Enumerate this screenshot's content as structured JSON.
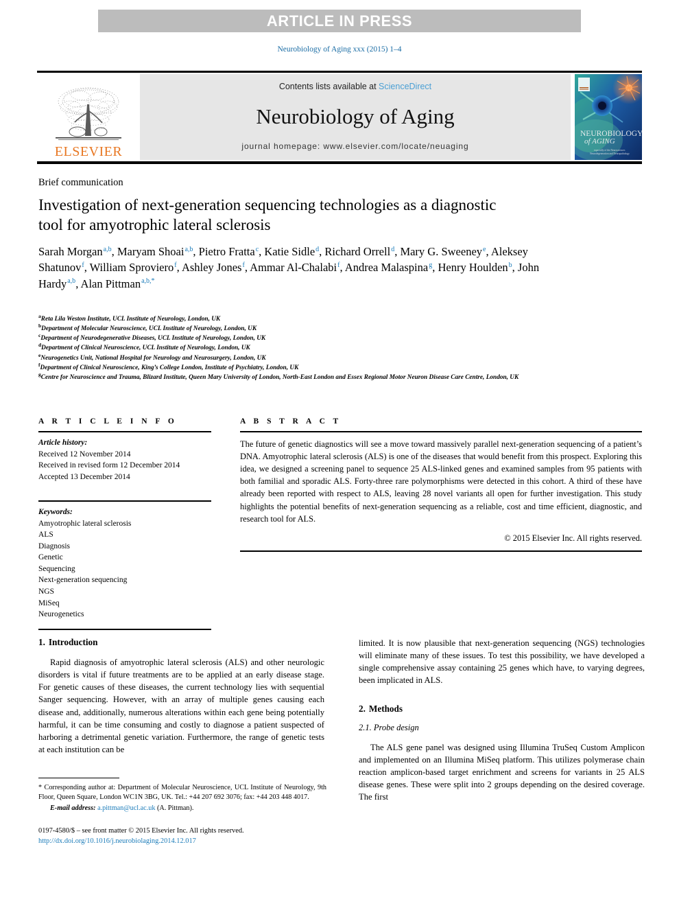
{
  "banner": {
    "label": "ARTICLE IN PRESS"
  },
  "running_head": "Neurobiology of Aging xxx (2015) 1–4",
  "masthead": {
    "contents_prefix": "Contents lists available at ",
    "sciencedirect": "ScienceDirect",
    "journal_title": "Neurobiology of Aging",
    "homepage": "journal homepage: www.elsevier.com/locate/neuaging",
    "publisher_wordmark": "ELSEVIER",
    "cover_title_line1": "NEUROBIOLOGY",
    "cover_title_line2": "of AGING",
    "cover_subtitle_line1": "especially of the Neurosciences",
    "cover_subtitle_line2": "Neurodegeneration and Neuropathology"
  },
  "colors": {
    "link_blue": "#1a7bb9",
    "sciencedirect_blue": "#4a9fd4",
    "elsevier_orange": "#e87722",
    "banner_grey": "#bcbcbc",
    "masthead_grey": "#e6e6e6"
  },
  "article_type": "Brief communication",
  "title": "Investigation of next-generation sequencing technologies as a diagnostic tool for amyotrophic lateral sclerosis",
  "authors": [
    {
      "name": "Sarah Morgan",
      "sup": "a,b",
      "sep": ", "
    },
    {
      "name": "Maryam Shoai",
      "sup": "a,b",
      "sep": ", "
    },
    {
      "name": "Pietro Fratta",
      "sup": "c",
      "sep": ", "
    },
    {
      "name": "Katie Sidle",
      "sup": "d",
      "sep": ", "
    },
    {
      "name": "Richard Orrell",
      "sup": "d",
      "sep": ", "
    },
    {
      "name": "Mary G. Sweeney",
      "sup": "e",
      "sep": ", "
    },
    {
      "name": "Aleksey Shatunov",
      "sup": "f",
      "sep": ", "
    },
    {
      "name": "William Sproviero",
      "sup": "f",
      "sep": ", "
    },
    {
      "name": "Ashley Jones",
      "sup": "f",
      "sep": ", "
    },
    {
      "name": "Ammar Al-Chalabi",
      "sup": "f",
      "sep": ", "
    },
    {
      "name": "Andrea Malaspina",
      "sup": "g",
      "sep": ", "
    },
    {
      "name": "Henry Houlden",
      "sup": "b",
      "sep": ", "
    },
    {
      "name": "John Hardy",
      "sup": "a,b",
      "sep": ", "
    },
    {
      "name": "Alan Pittman",
      "sup": "a,b,*",
      "sep": ""
    }
  ],
  "affiliations": [
    {
      "mark": "a",
      "text": "Reta Lila Weston Institute, UCL Institute of Neurology, London, UK"
    },
    {
      "mark": "b",
      "text": "Department of Molecular Neuroscience, UCL Institute of Neurology, London, UK"
    },
    {
      "mark": "c",
      "text": "Department of Neurodegenerative Diseases, UCL Institute of Neurology, London, UK"
    },
    {
      "mark": "d",
      "text": "Department of Clinical Neuroscience, UCL Institute of Neurology, London, UK"
    },
    {
      "mark": "e",
      "text": "Neurogenetics Unit, National Hospital for Neurology and Neurosurgery, London, UK"
    },
    {
      "mark": "f",
      "text": "Department of Clinical Neuroscience, King’s College London, Institute of Psychiatry, London, UK"
    },
    {
      "mark": "g",
      "text": "Centre for Neuroscience and Trauma, Blizard Institute, Queen Mary University of London, North-East London and Essex Regional Motor Neuron Disease Care Centre, London, UK"
    }
  ],
  "article_info": {
    "heading": "A R T I C L E  I N F O",
    "history_label": "Article history:",
    "history": [
      "Received 12 November 2014",
      "Received in revised form 12 December 2014",
      "Accepted 13 December 2014"
    ],
    "keywords_label": "Keywords:",
    "keywords": [
      "Amyotrophic lateral sclerosis",
      "ALS",
      "Diagnosis",
      "Genetic",
      "Sequencing",
      "Next-generation sequencing",
      "NGS",
      "MiSeq",
      "Neurogenetics"
    ]
  },
  "abstract": {
    "heading": "A B S T R A C T",
    "text": "The future of genetic diagnostics will see a move toward massively parallel next-generation sequencing of a patient’s DNA. Amyotrophic lateral sclerosis (ALS) is one of the diseases that would benefit from this prospect. Exploring this idea, we designed a screening panel to sequence 25 ALS-linked genes and examined samples from 95 patients with both familial and sporadic ALS. Forty-three rare polymorphisms were detected in this cohort. A third of these have already been reported with respect to ALS, leaving 28 novel variants all open for further investigation. This study highlights the potential benefits of next-generation sequencing as a reliable, cost and time efficient, diagnostic, and research tool for ALS.",
    "copyright": "© 2015 Elsevier Inc. All rights reserved."
  },
  "body": {
    "left_column": {
      "section_number": "1.",
      "section_title": "Introduction",
      "paragraph": "Rapid diagnosis of amyotrophic lateral sclerosis (ALS) and other neurologic disorders is vital if future treatments are to be applied at an early disease stage. For genetic causes of these diseases, the current technology lies with sequential Sanger sequencing. However, with an array of multiple genes causing each disease and, additionally, numerous alterations within each gene being potentially harmful, it can be time consuming and costly to diagnose a patient suspected of harboring a detrimental genetic variation. Furthermore, the range of genetic tests at each institution can be"
    },
    "right_column": {
      "paragraph_continued": "limited. It is now plausible that next-generation sequencing (NGS) technologies will eliminate many of these issues. To test this possibility, we have developed a single comprehensive assay containing 25 genes which have, to varying degrees, been implicated in ALS.",
      "section_number": "2.",
      "section_title": "Methods",
      "subsection_number": "2.1.",
      "subsection_title": "Probe design",
      "paragraph": "The ALS gene panel was designed using Illumina TruSeq Custom Amplicon and implemented on an Illumina MiSeq platform. This utilizes polymerase chain reaction amplicon-based target enrichment and screens for variants in 25 ALS disease genes. These were split into 2 groups depending on the desired coverage. The first"
    }
  },
  "footnote": {
    "corresponding": "* Corresponding author at: Department of Molecular Neuroscience, UCL Institute of Neurology, 9th Floor, Queen Square, London WC1N 3BG, UK. Tel.: +44 207 692 3076; fax: +44 203 448 4017.",
    "email_label": "E-mail address:",
    "email": "a.pittman@ucl.ac.uk",
    "email_suffix": "(A. Pittman)."
  },
  "frontmatter": {
    "issn_line": "0197-4580/$ – see front matter © 2015 Elsevier Inc. All rights reserved.",
    "doi": "http://dx.doi.org/10.1016/j.neurobiolaging.2014.12.017"
  }
}
